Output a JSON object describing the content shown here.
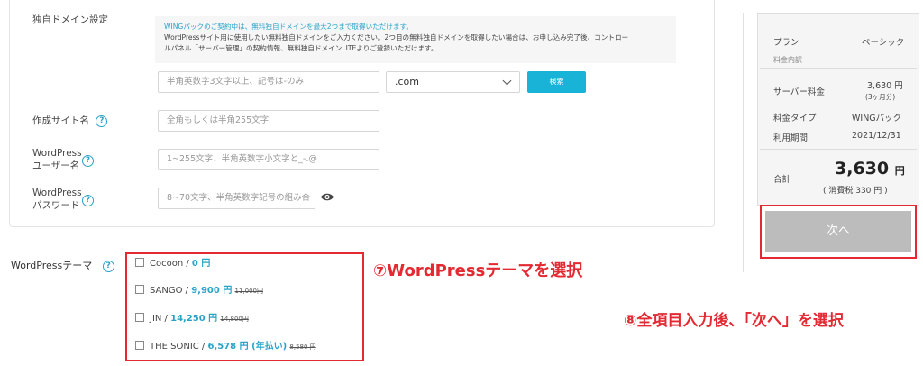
{
  "domain_section": {
    "label": "独自ドメイン設定",
    "info_line1": "WINGパックのご契約中は、無料独自ドメインを最大2つまで取得いただけます。",
    "info_line2": "WordPressサイト用に使用したい無料独自ドメインをご入力ください。2つ目の無料独自ドメインを取得したい場合は、お申し込み完了後、コントロー",
    "info_line3": "ルパネル「サーバー管理」の契約情報、無料独自ドメインLITEよりご登録いただけます。",
    "domain_placeholder": "半角英数字3文字以上、記号は-のみ",
    "tld_selected": ".com",
    "search_label": "検索"
  },
  "site_name": {
    "label": "作成サイト名",
    "placeholder": "全角もしくは半角255文字"
  },
  "wp_user": {
    "label_line1": "WordPress",
    "label_line2": "ユーザー名",
    "placeholder": "1~255文字、半角英数字小文字と_-.@"
  },
  "wp_password": {
    "label_line1": "WordPress",
    "label_line2": "パスワード",
    "placeholder": "8~70文字、半角英数字記号の組み合"
  },
  "theme": {
    "label": "WordPressテーマ",
    "options": [
      {
        "name": "Cocoon / ",
        "price": "0 円",
        "old_price": ""
      },
      {
        "name": "SANGO / ",
        "price": "9,900 円",
        "old_price": "11,000円"
      },
      {
        "name": "JIN / ",
        "price": "14,250 円",
        "old_price": "14,800円"
      },
      {
        "name": "THE SONIC / ",
        "price": "6,578 円 (年払い)",
        "old_price": "8,580 円"
      }
    ]
  },
  "summary": {
    "plan_label": "プラン",
    "plan_value": "ベーシック",
    "breakdown_label": "料金内訳",
    "server_fee_label": "サーバー料金",
    "server_fee_value": "3,630 円",
    "server_fee_note": "(3ヶ月分)",
    "fee_type_label": "料金タイプ",
    "fee_type_value": "WINGパック",
    "period_label": "利用期間",
    "period_value": "2021/12/31",
    "total_label": "合計",
    "total_amount": "3,630",
    "total_unit": "円",
    "tax_note": "( 消費税 330 円 )",
    "next_label": "次へ"
  },
  "annotations": {
    "step7": "⑦WordPressテーマを選択",
    "step8": "⑧全項目入力後、「次へ」を選択"
  },
  "colors": {
    "accent": "#2aa3c8",
    "search_button": "#18b3d6",
    "annotation_red": "#e32a32",
    "next_button": "#bcbcbc"
  }
}
